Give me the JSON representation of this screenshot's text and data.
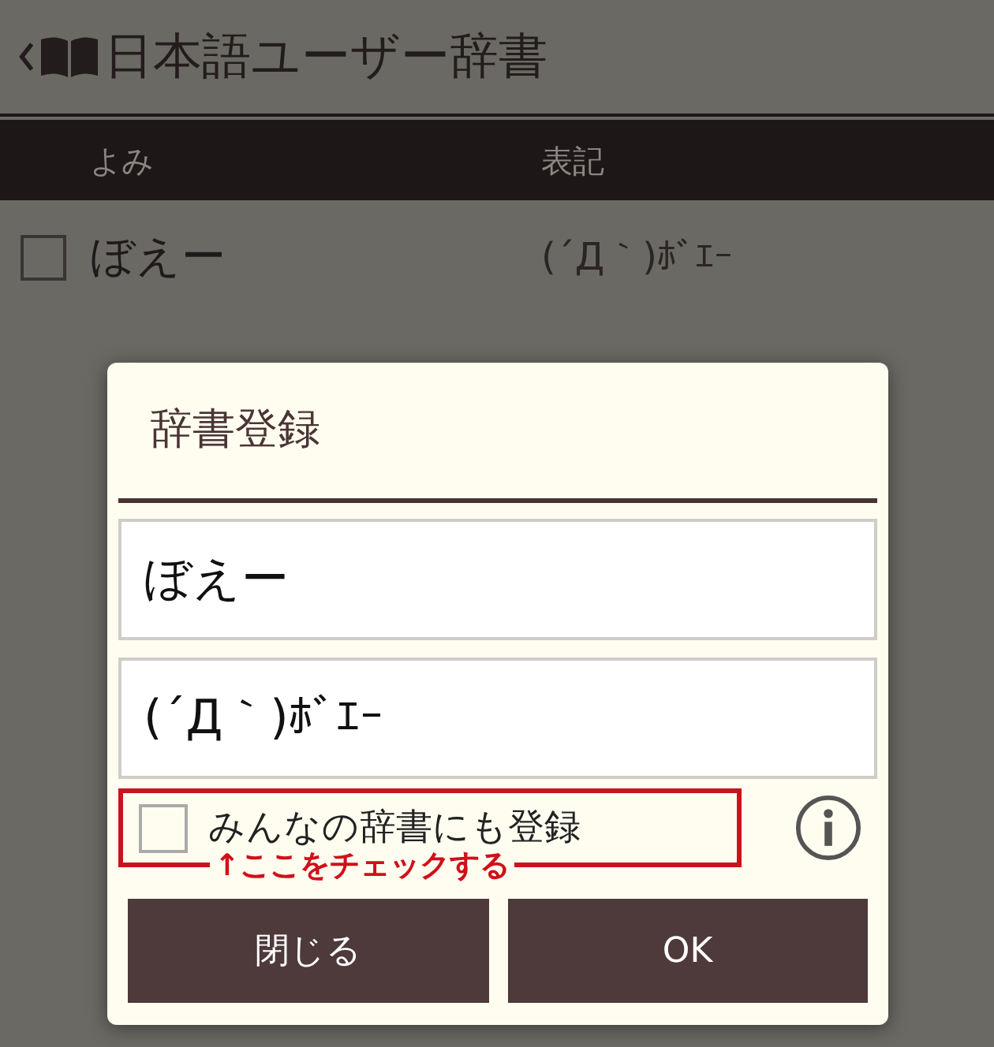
{
  "app_bar": {
    "title": "日本語ユーザー辞書"
  },
  "table": {
    "columns": [
      "よみ",
      "表記"
    ],
    "rows": [
      {
        "checked": false,
        "reading": "ぼえー",
        "notation": "(´Д｀)ﾎﾞｴｰ"
      }
    ]
  },
  "dialog": {
    "title": "辞書登録",
    "fields": [
      {
        "value": "ぼえー"
      },
      {
        "value": "(´Д｀)ﾎﾞｴｰ"
      }
    ],
    "share_option": {
      "label": "みんなの辞書にも登録",
      "checked": false
    },
    "annotation": {
      "text": "↑ここをチェックする"
    },
    "buttons": [
      "閉じる",
      "OK"
    ]
  }
}
